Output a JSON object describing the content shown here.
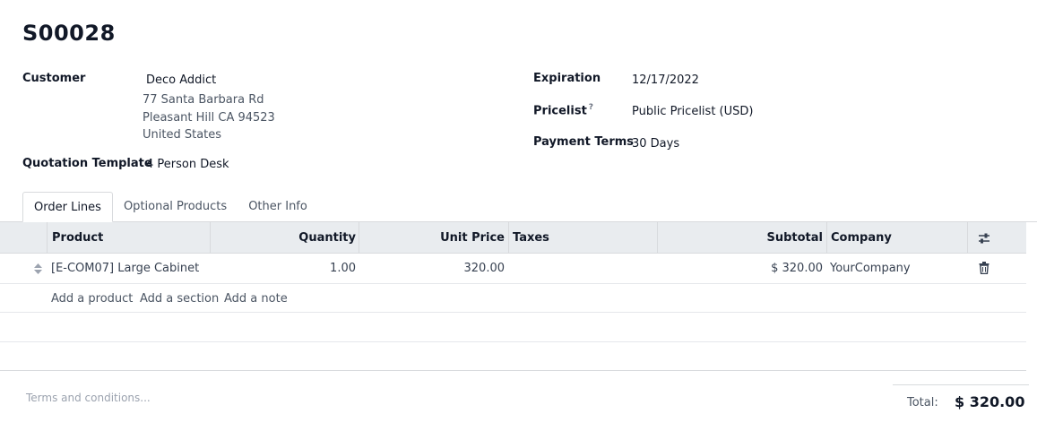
{
  "record": {
    "name": "S00028"
  },
  "fields": {
    "customer_label": "Customer",
    "customer_name": "Deco Addict",
    "address_line1": "77 Santa Barbara Rd",
    "address_line2": "Pleasant Hill CA 94523",
    "address_line3": "United States",
    "quotation_template_label": "Quotation Template",
    "quotation_template_value": "4 Person Desk",
    "expiration_label": "Expiration",
    "expiration_value": "12/17/2022",
    "pricelist_label": "Pricelist",
    "pricelist_help": "?",
    "pricelist_value": "Public Pricelist (USD)",
    "payment_terms_label": "Payment Terms",
    "payment_terms_value": "30 Days"
  },
  "tabs": [
    {
      "label": "Order Lines",
      "active": true
    },
    {
      "label": "Optional Products",
      "active": false
    },
    {
      "label": "Other Info",
      "active": false
    }
  ],
  "table": {
    "headers": {
      "product": "Product",
      "quantity": "Quantity",
      "unit_price": "Unit Price",
      "taxes": "Taxes",
      "subtotal": "Subtotal",
      "company": "Company"
    },
    "rows": [
      {
        "product": "[E-COM07] Large Cabinet",
        "quantity": "1.00",
        "unit_price": "320.00",
        "taxes": "",
        "subtotal": "$ 320.00",
        "company": "YourCompany"
      }
    ],
    "actions": {
      "add_product": "Add a product",
      "add_section": "Add a section",
      "add_note": "Add a note"
    }
  },
  "footer": {
    "terms_placeholder": "Terms and conditions...",
    "total_label": "Total:",
    "total_value": "$ 320.00"
  },
  "colors": {
    "header_bg": "#e9ecef",
    "border": "#d8dadd",
    "text_dark": "#111827",
    "text_muted": "#4b5563"
  },
  "icons": {
    "optional_columns": "sliders-icon",
    "row_handle": "drag-handle-icon",
    "delete": "trash-icon"
  }
}
